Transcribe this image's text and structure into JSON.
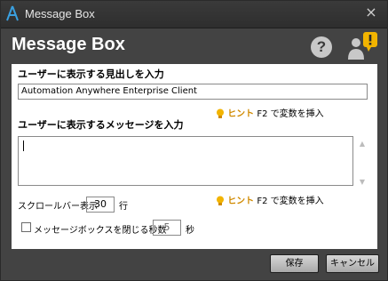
{
  "window": {
    "title": "Message Box",
    "close_glyph": "×"
  },
  "header": {
    "heading": "Message Box",
    "help_glyph": "?"
  },
  "form": {
    "header_label": "ユーザーに表示する見出しを入力",
    "header_value": "Automation Anywhere Enterprise Client",
    "hint_label": "ヒント",
    "hint_text": "F2 で変数を挿入",
    "message_label": "ユーザーに表示するメッセージを入力",
    "message_value": "",
    "scrollbar_label": "スクロールバー表示",
    "scrollbar_lines": "30",
    "scrollbar_unit": "行",
    "close_label": "メッセージボックスを閉じる秒数",
    "close_checked": false,
    "close_seconds": "5",
    "close_unit": "秒"
  },
  "buttons": {
    "save": "保存",
    "cancel": "キャンセル"
  },
  "colors": {
    "background": "#434343",
    "panel": "#ffffff",
    "hint": "#d08a00",
    "badge": "#f2b400"
  }
}
